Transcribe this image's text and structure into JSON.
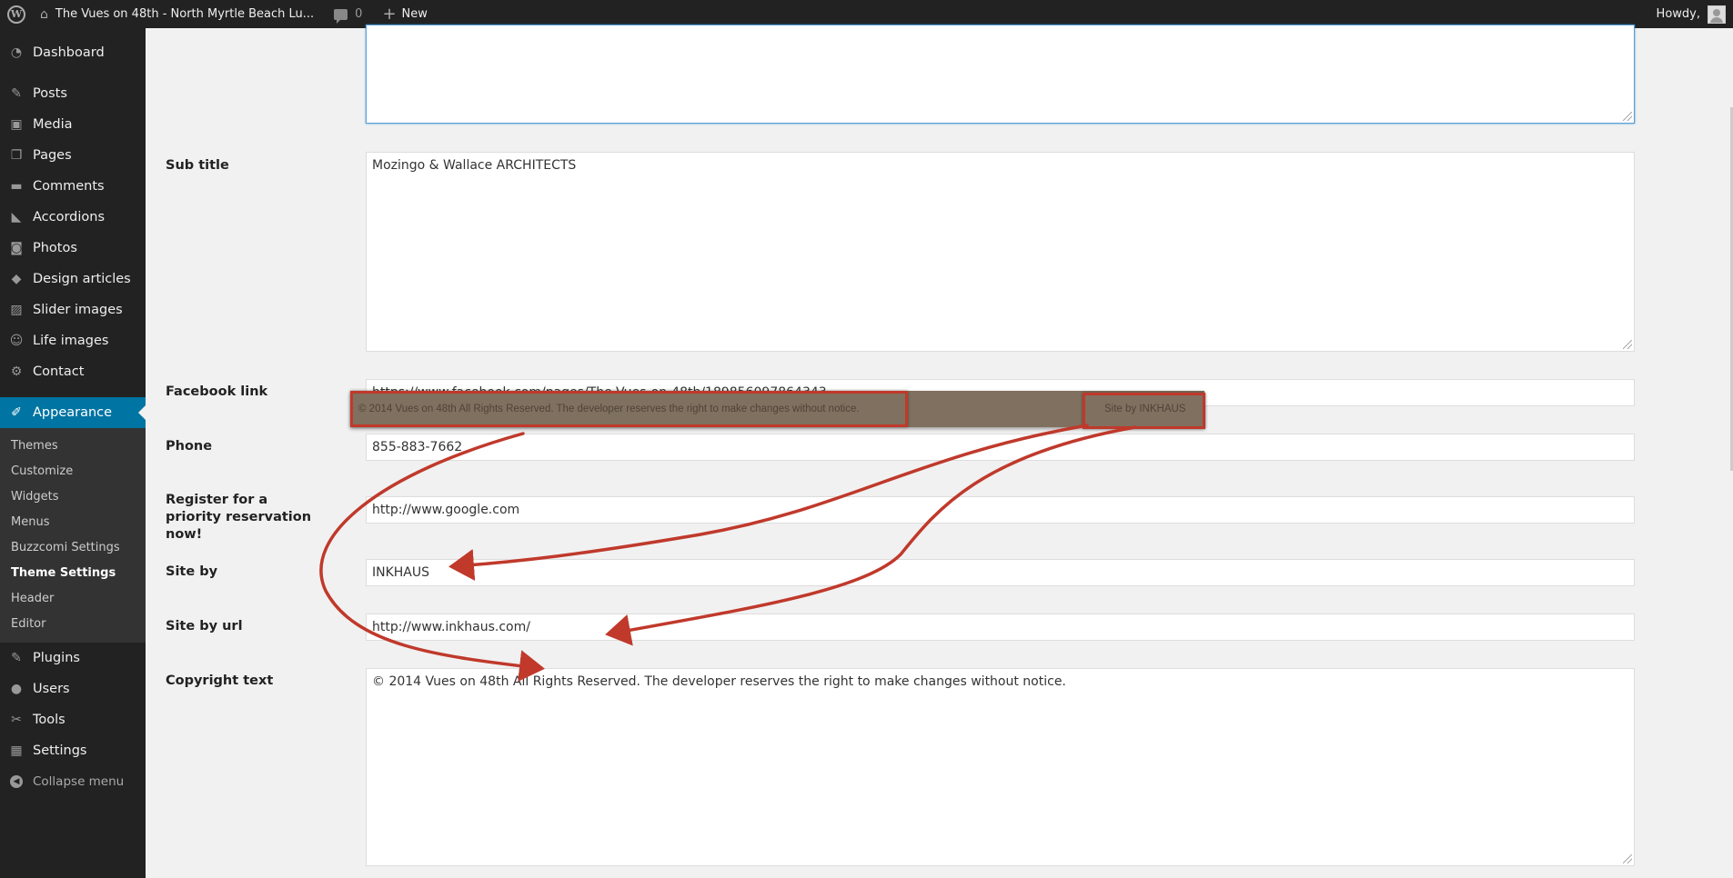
{
  "adminbar": {
    "site_title": "The Vues on 48th - North Myrtle Beach Lu...",
    "comments_count": "0",
    "new_label": "New",
    "howdy": "Howdy,"
  },
  "sidebar": {
    "items": [
      {
        "label": "Dashboard",
        "icon": "dashboard-icon",
        "glyph": "◔"
      },
      {
        "label": "Posts",
        "icon": "pin-icon",
        "glyph": "✎"
      },
      {
        "label": "Media",
        "icon": "media-icon",
        "glyph": "▣"
      },
      {
        "label": "Pages",
        "icon": "pages-icon",
        "glyph": "❐"
      },
      {
        "label": "Comments",
        "icon": "comment-icon",
        "glyph": "▬"
      },
      {
        "label": "Accordions",
        "icon": "accordion-icon",
        "glyph": "◣"
      },
      {
        "label": "Photos",
        "icon": "camera-icon",
        "glyph": "◙"
      },
      {
        "label": "Design articles",
        "icon": "drop-icon",
        "glyph": "◆"
      },
      {
        "label": "Slider images",
        "icon": "image-icon",
        "glyph": "▨"
      },
      {
        "label": "Life images",
        "icon": "smiley-icon",
        "glyph": "☺"
      },
      {
        "label": "Contact",
        "icon": "gear-icon",
        "glyph": "⚙"
      }
    ],
    "appearance": {
      "label": "Appearance",
      "icon": "brush-icon",
      "glyph": "✐"
    },
    "submenu": [
      "Themes",
      "Customize",
      "Widgets",
      "Menus",
      "Buzzcomi Settings",
      "Theme Settings",
      "Header",
      "Editor"
    ],
    "current_submenu": "Theme Settings",
    "bottom_items": [
      {
        "label": "Plugins",
        "icon": "plug-icon",
        "glyph": "✎"
      },
      {
        "label": "Users",
        "icon": "user-icon",
        "glyph": "●"
      },
      {
        "label": "Tools",
        "icon": "wrench-icon",
        "glyph": "✂"
      },
      {
        "label": "Settings",
        "icon": "settings-icon",
        "glyph": "▦"
      }
    ],
    "collapse_label": "Collapse menu"
  },
  "form": {
    "subtitle_label": "Sub title",
    "subtitle_value": "Mozingo & Wallace ARCHITECTS",
    "facebook_label": "Facebook link",
    "facebook_value": "https://www.facebook.com/pages/The-Vues-on-48th/189856097864343",
    "phone_label": "Phone",
    "phone_value": "855-883-7662",
    "register_label": "Register for a priority reservation now!",
    "register_value": "http://www.google.com",
    "siteby_label": "Site by",
    "siteby_value": "INKHAUS",
    "siteby_url_label": "Site by url",
    "siteby_url_value": "http://www.inkhaus.com/",
    "copyright_label": "Copyright text",
    "copyright_value": "© 2014 Vues on 48th All Rights Reserved. The developer reserves the right to make changes without notice."
  },
  "footer_preview": {
    "copyright": "© 2014 Vues on 48th All Rights Reserved. The developer reserves the right to make changes without notice.",
    "site_by": "Site by INKHAUS",
    "highlight_color": "#c0392b",
    "background_color": "#80705f"
  },
  "colors": {
    "accent": "#0074a2",
    "sidebar_bg": "#222222",
    "page_bg": "#f1f1f1",
    "arrow": "#c0392b"
  }
}
